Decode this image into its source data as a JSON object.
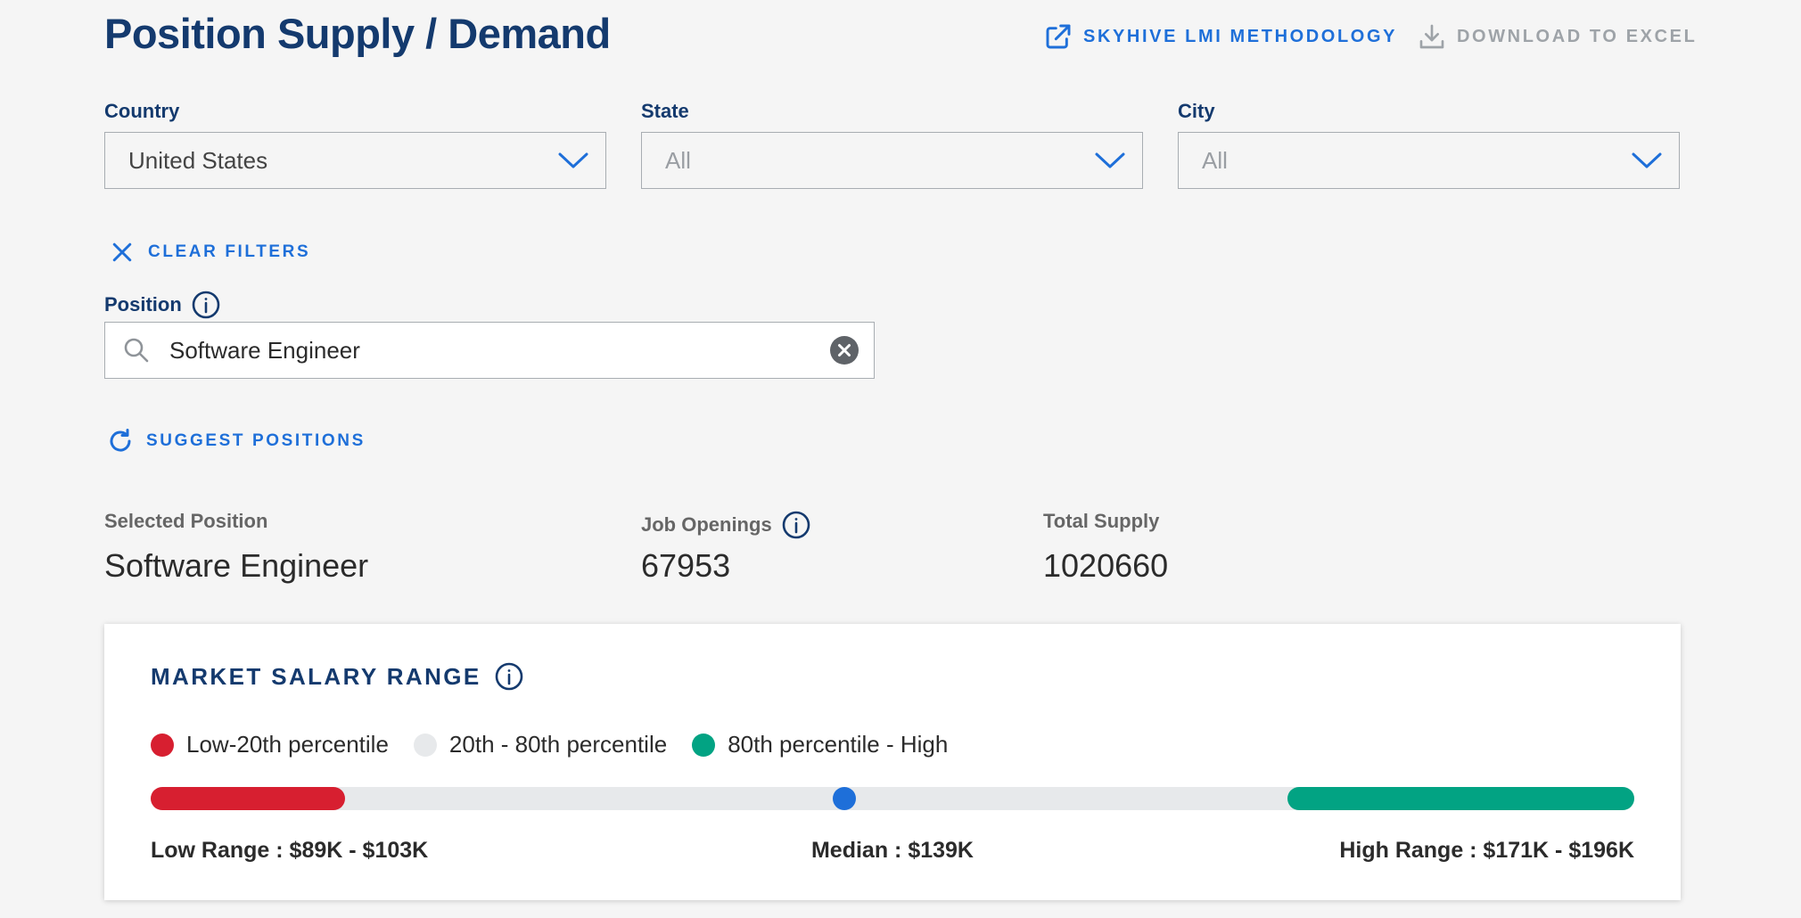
{
  "page_title": "Position Supply / Demand",
  "header_links": {
    "methodology": "SKYHIVE LMI METHODOLOGY",
    "download": "DOWNLOAD TO EXCEL"
  },
  "filters": {
    "country": {
      "label": "Country",
      "value": "United States"
    },
    "state": {
      "label": "State",
      "value": "All"
    },
    "city": {
      "label": "City",
      "value": "All"
    },
    "clear_label": "CLEAR FILTERS"
  },
  "position": {
    "label": "Position",
    "search_value": "Software Engineer",
    "suggest_label": "SUGGEST POSITIONS"
  },
  "stats": {
    "selected_position": {
      "label": "Selected Position",
      "value": "Software Engineer"
    },
    "job_openings": {
      "label": "Job Openings",
      "value": "67953"
    },
    "total_supply": {
      "label": "Total Supply",
      "value": "1020660"
    }
  },
  "salary": {
    "title": "MARKET SALARY RANGE",
    "legend": [
      {
        "label": "Low-20th percentile",
        "color": "#d71f30"
      },
      {
        "label": "20th - 80th percentile",
        "color": "#e7e9eb"
      },
      {
        "label": "80th percentile - High",
        "color": "#02a383"
      }
    ],
    "low_range": "Low Range : $89K - $103K",
    "median": "Median : $139K",
    "high_range": "High Range : $171K - $196K",
    "low_min_k": 89,
    "low_max_k": 103,
    "median_k": 139,
    "high_min_k": 171,
    "high_max_k": 196,
    "median_color": "#1e6fd9"
  },
  "colors": {
    "title_navy": "#143a6e",
    "link_blue": "#1e6fd9",
    "disabled_gray": "#9ea3a8"
  }
}
